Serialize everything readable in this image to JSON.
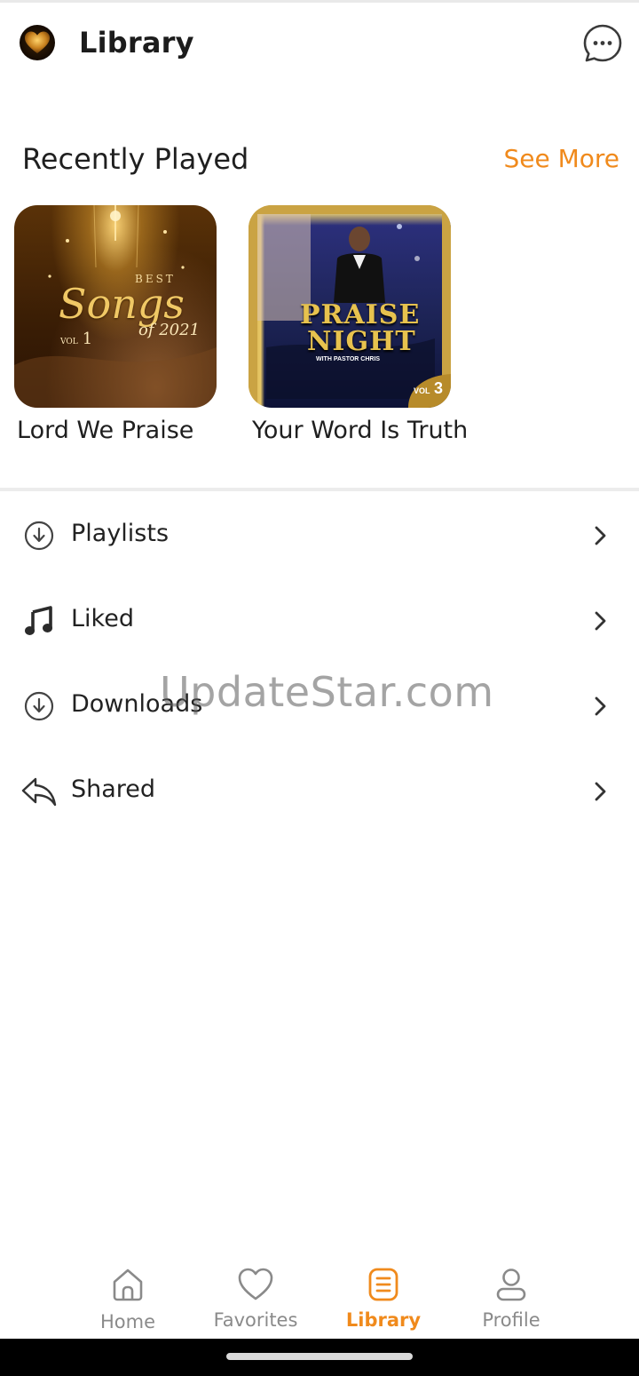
{
  "header": {
    "title": "Library",
    "logo_icon": "heart-logo-icon",
    "chat_icon": "chat-bubble-icon"
  },
  "recently_played": {
    "title": "Recently Played",
    "see_more": "See More",
    "items": [
      {
        "title": "Lord We Praise",
        "cover_text": {
          "line1": "BEST",
          "line2": "Songs",
          "line3": "of 2021",
          "vol_label": "VOL",
          "vol_number": "1"
        }
      },
      {
        "title": "Your Word Is Truth",
        "cover_text": {
          "line1": "PRAISE",
          "line2": "NIGHT",
          "line3": "WITH PASTOR CHRIS",
          "vol_label": "VOL",
          "vol_number": "3"
        }
      }
    ]
  },
  "menu": {
    "items": [
      {
        "label": "Playlists",
        "icon": "download-circle-icon"
      },
      {
        "label": "Liked",
        "icon": "music-note-icon"
      },
      {
        "label": "Downloads",
        "icon": "download-circle-icon"
      },
      {
        "label": "Shared",
        "icon": "reply-arrow-icon"
      }
    ]
  },
  "watermark": "UpdateStar.com",
  "bottom_nav": {
    "items": [
      {
        "label": "Home",
        "icon": "home-icon",
        "active": false
      },
      {
        "label": "Favorites",
        "icon": "heart-icon",
        "active": false
      },
      {
        "label": "Library",
        "icon": "library-icon",
        "active": true
      },
      {
        "label": "Profile",
        "icon": "profile-icon",
        "active": false
      }
    ]
  },
  "colors": {
    "accent": "#f08a1c",
    "text": "#1f1f1f",
    "muted": "#8a8a8a"
  }
}
